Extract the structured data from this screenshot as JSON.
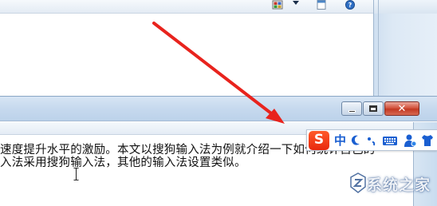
{
  "background_window": {
    "toolbar_icons": [
      "grid-icon",
      "dropdown-arrow-icon",
      "page-icon",
      "help-icon"
    ]
  },
  "foreground_window": {
    "buttons": {
      "minimize": "minimize",
      "maximize": "maximize",
      "close_glyph": "✕"
    },
    "document": {
      "line1": "速度提升水平的激励。本文以搜狗输入法为例就介绍一下如何统计自己的",
      "line2": "入法采用搜狗输入法，其他的输入法设置类似。"
    }
  },
  "ime_toolbar": {
    "logo": "S",
    "mode": "中",
    "icons": [
      "moon-icon",
      "punctuation-icon",
      "keyboard-icon",
      "user-icon",
      "skin-icon"
    ]
  },
  "watermark": {
    "text": "系统之家"
  },
  "colors": {
    "arrow": "#e8231d",
    "ime_logo": "#f0401a",
    "ime_accent": "#1a5fd1"
  }
}
